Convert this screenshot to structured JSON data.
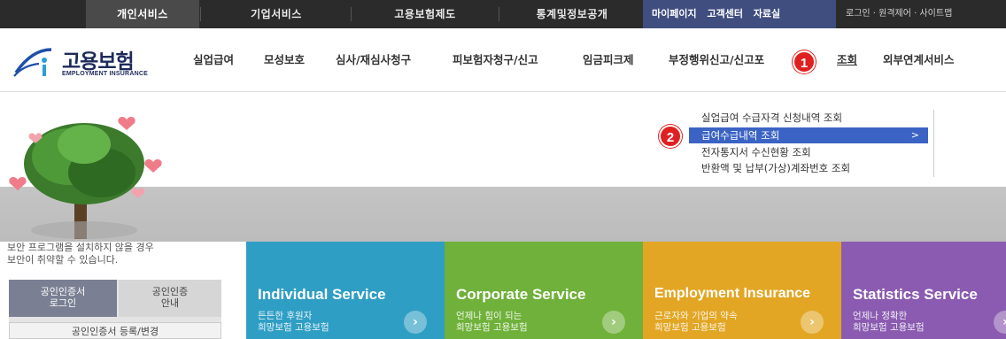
{
  "topbar": {
    "tabs": [
      "개인서비스",
      "기업서비스",
      "고용보험제도",
      "통계및정보공개"
    ],
    "util": [
      "마이페이지",
      "고객센터",
      "자료실"
    ],
    "right": "로그인 · 원격제어 · 사이트맵"
  },
  "logo": {
    "korean": "고용보험",
    "english": "EMPLOYMENT INSURANCE"
  },
  "nav": [
    "실업급여",
    "모성보호",
    "심사/재심사청구",
    "피보험자청구/신고",
    "임금피크제",
    "부정행위신고/신고포",
    "조회",
    "외부연계서비스"
  ],
  "badges": [
    "1",
    "2"
  ],
  "submenu": {
    "items": [
      "실업급여 수급자격 신청내역 조회",
      "급여수급내역 조회",
      "전자통지서 수신현황 조회",
      "반환액 및 납부(가상)계좌번호 조회"
    ],
    "chevron": ">"
  },
  "notice": "보안 프로그램을 설치하지 않을 경우\n보안이 취약할 수 있습니다.",
  "cert": {
    "login": "공인인증서\n로그인",
    "guide": "공인인증\n안내",
    "register": "공인인증서 등록/변경"
  },
  "services": [
    {
      "title": "Individual Service",
      "desc": "든든한 후원자\n희망보험 고용보험",
      "color": "#2f9ec4"
    },
    {
      "title": "Corporate Service",
      "desc": "언제나 힘이 되는\n희망보험 고용보험",
      "color": "#6fb13a"
    },
    {
      "title": "Employment Insurance",
      "desc": "근로자와 기업의 약속\n희망보험 고용보험",
      "color": "#e2a624"
    },
    {
      "title": "Statistics Service",
      "desc": "언제나 정확한\n희망보험 고용보험",
      "color": "#8a5bb0"
    }
  ],
  "icons": {
    "arrow": "chevron-right-icon"
  }
}
